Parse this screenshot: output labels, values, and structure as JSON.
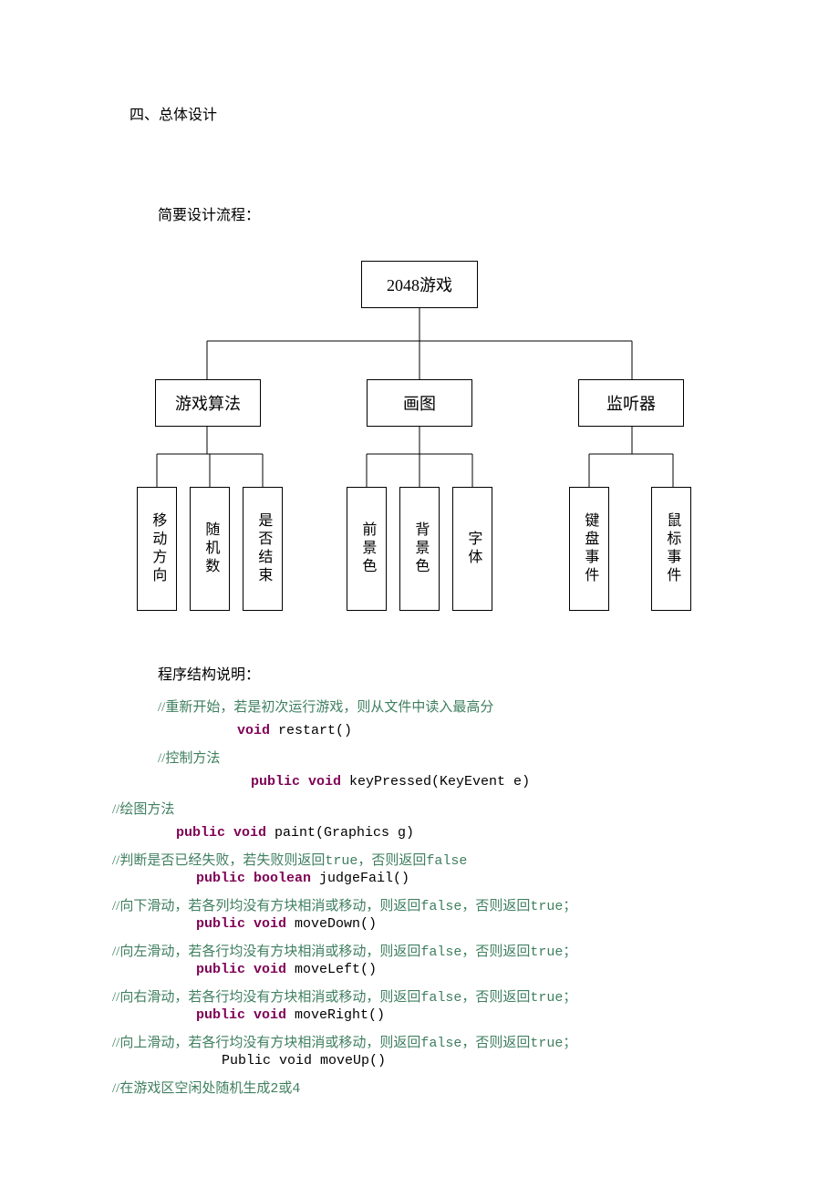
{
  "heading": "四、总体设计",
  "subheading": "简要设计流程：",
  "tree": {
    "root": "2048游戏",
    "level2": [
      "游戏算法",
      "画图",
      "监听器"
    ],
    "leaves": {
      "g1": [
        "移动方向",
        "随机数",
        "是否结束"
      ],
      "g2": [
        "前景色",
        "背景色",
        "字体"
      ],
      "g3": [
        "键盘事件",
        "鼠标事件"
      ]
    }
  },
  "desc_title": "程序结构说明：",
  "methods": [
    {
      "comment": "//重新开始，若是初次运行游戏，则从文件中读入最高分",
      "kw": "void",
      "sig": " restart()"
    },
    {
      "comment": "//控制方法",
      "kw": "public void",
      "sig": " keyPressed(KeyEvent e)"
    },
    {
      "comment": "//绘图方法",
      "kw": "public void",
      "sig": " paint(Graphics g)"
    },
    {
      "comment": "//判断是否已经失败，若失败则返回true，否则返回false",
      "kw": "public boolean",
      "sig": " judgeFail()"
    },
    {
      "comment": "//向下滑动，若各列均没有方块相消或移动，则返回false，否则返回true；",
      "kw": "public void",
      "sig": " moveDown()"
    },
    {
      "comment": "//向左滑动，若各行均没有方块相消或移动，则返回false，否则返回true；",
      "kw": "public void",
      "sig": " moveLeft()"
    },
    {
      "comment": "//向右滑动，若各行均没有方块相消或移动，则返回false，否则返回true；",
      "kw": "public void",
      "sig": " moveRight()"
    },
    {
      "comment": "//向上滑动，若各行均没有方块相消或移动，则返回false，否则返回true；",
      "kw": "",
      "sig": "Public void moveUp()"
    },
    {
      "comment": "//在游戏区空闲处随机生成2或4",
      "kw": "",
      "sig": ""
    }
  ]
}
